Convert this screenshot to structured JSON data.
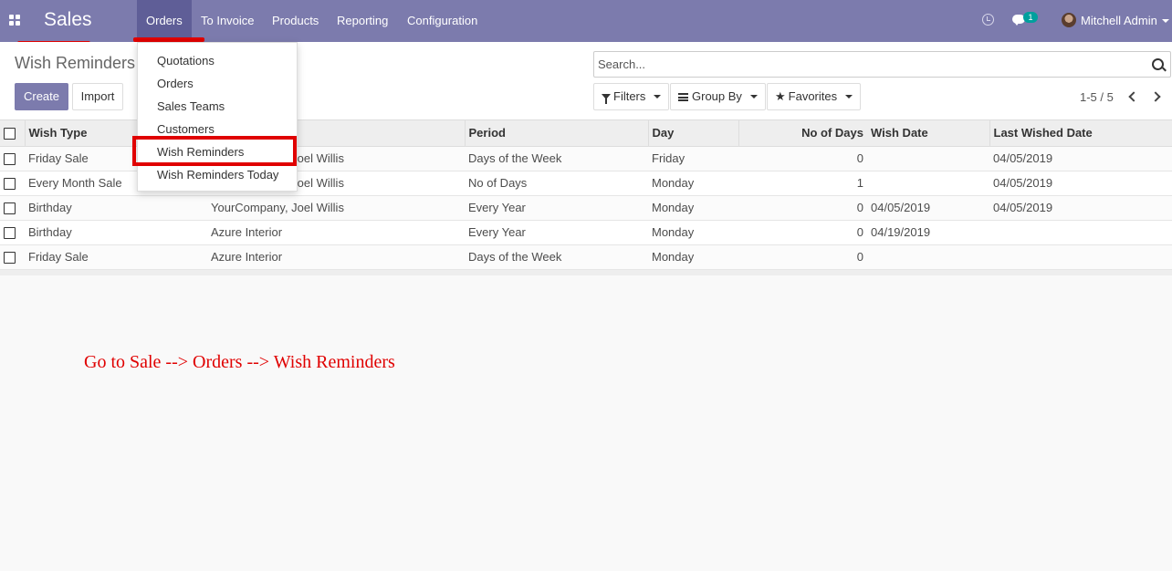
{
  "navbar": {
    "brand": "Sales",
    "menus": [
      "Orders",
      "To Invoice",
      "Products",
      "Reporting",
      "Configuration"
    ],
    "active_menu": "Orders",
    "chat_count": "1",
    "user_name": "Mitchell Admin",
    "icons": [
      "apps-icon",
      "clock-icon",
      "chat-icon",
      "avatar"
    ]
  },
  "colors": {
    "brand": "#7c7bad",
    "active_menu": "#5f5e97",
    "highlight": "#e00000",
    "badge": "#00a09d"
  },
  "page": {
    "title": "Wish Reminders",
    "create_label": "Create",
    "import_label": "Import"
  },
  "search": {
    "placeholder": "Search...",
    "filters_label": "Filters",
    "group_by_label": "Group By",
    "favorites_label": "Favorites"
  },
  "pager": {
    "text": "1-5 / 5"
  },
  "orders_menu": {
    "items": [
      "Quotations",
      "Orders",
      "Sales Teams",
      "Customers",
      "Wish Reminders",
      "Wish Reminders Today"
    ],
    "highlighted": "Wish Reminders"
  },
  "table": {
    "columns": [
      "Wish Type",
      "",
      "Period",
      "Day",
      "No of Days",
      "Wish Date",
      "Last Wished Date"
    ],
    "rows": [
      [
        "Friday Sale",
        "YourCompany, Joel Willis",
        "Days of the Week",
        "Friday",
        "0",
        "",
        "04/05/2019"
      ],
      [
        "Every Month Sale",
        "YourCompany, Joel Willis",
        "No of Days",
        "Monday",
        "1",
        "",
        "04/05/2019"
      ],
      [
        "Birthday",
        "YourCompany, Joel Willis",
        "Every Year",
        "Monday",
        "0",
        "04/05/2019",
        "04/05/2019"
      ],
      [
        "Birthday",
        "Azure Interior",
        "Every Year",
        "Monday",
        "0",
        "04/19/2019",
        ""
      ],
      [
        "Friday Sale",
        "Azure Interior",
        "Days of the Week",
        "Monday",
        "0",
        "",
        ""
      ]
    ]
  },
  "annotation": "Go to Sale --> Orders --> Wish Reminders"
}
